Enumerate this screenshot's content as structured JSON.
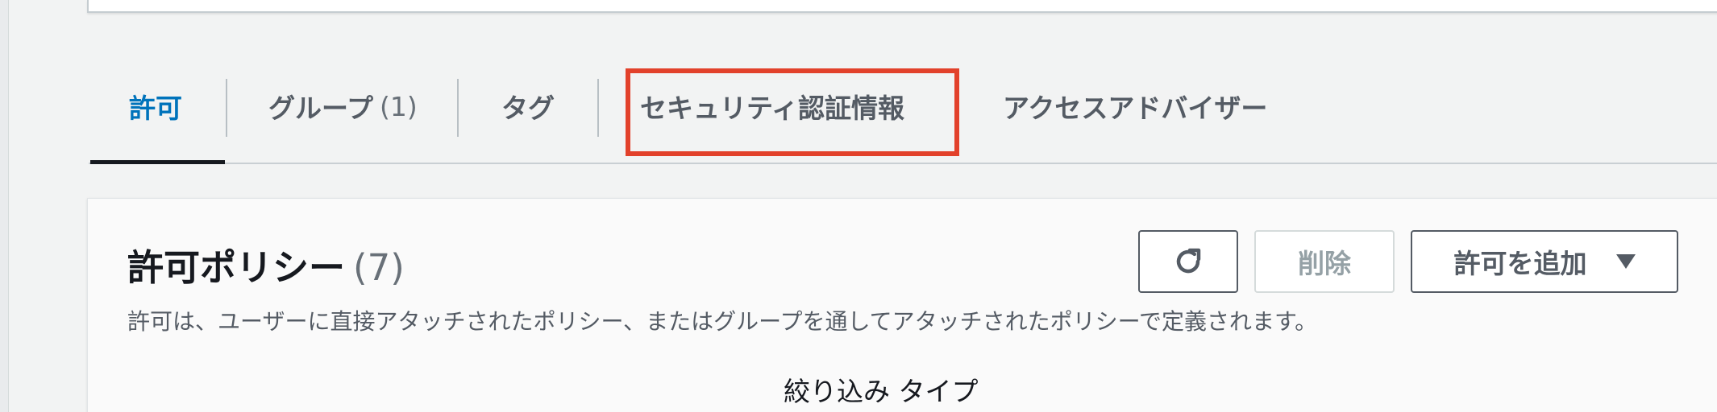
{
  "tabs": [
    {
      "label": "許可",
      "active": true
    },
    {
      "label": "グループ",
      "count": "(1)"
    },
    {
      "label": "タグ"
    },
    {
      "label": "セキュリティ認証情報",
      "highlighted": true
    },
    {
      "label": "アクセスアドバイザー"
    }
  ],
  "permissions": {
    "title": "許可ポリシー",
    "count": "(7)",
    "description": "許可は、ユーザーに直接アタッチされたポリシー、またはグループを通してアタッチされたポリシーで定義されます。",
    "buttons": {
      "refresh_icon": "refresh-icon",
      "delete_label": "削除",
      "add_label": "許可を追加",
      "add_dropdown_icon": "caret-down-icon"
    },
    "filter_label": "絞り込み タイプ"
  },
  "colors": {
    "active_tab": "#0073bb",
    "highlight_box": "#e2412b",
    "page_background": "#f2f3f3"
  }
}
